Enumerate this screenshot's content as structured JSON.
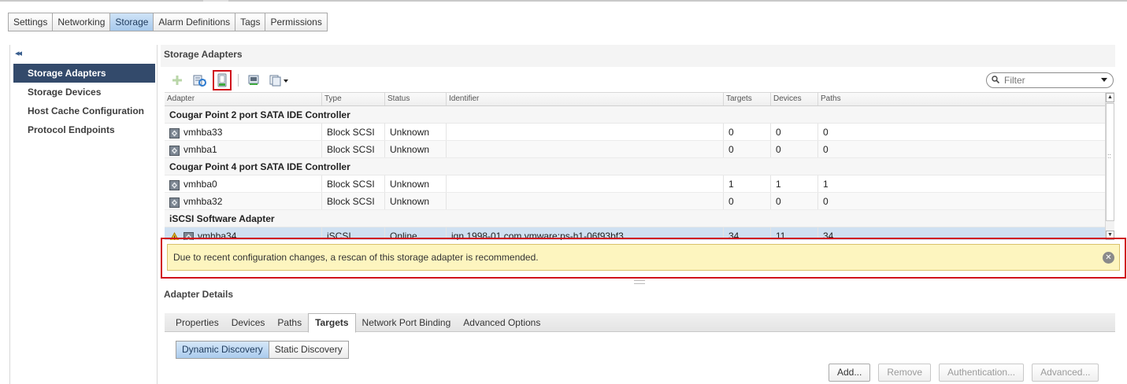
{
  "top_tabs": [
    "Settings",
    "Networking",
    "Storage",
    "Alarm Definitions",
    "Tags",
    "Permissions"
  ],
  "active_top_tab": "Storage",
  "sidebar": {
    "collapse_glyph": "◂◂",
    "items": [
      {
        "label": "Storage Adapters",
        "active": true
      },
      {
        "label": "Storage Devices",
        "active": false
      },
      {
        "label": "Host Cache Configuration",
        "active": false
      },
      {
        "label": "Protocol Endpoints",
        "active": false
      }
    ]
  },
  "main": {
    "title": "Storage Adapters",
    "toolbar_icons": [
      "add-icon",
      "rescan-all-icon",
      "rescan-adapter-icon",
      "adapter-settings-icon",
      "actions-menu-icon"
    ],
    "filter": {
      "placeholder": "Filter"
    },
    "columns": [
      "Adapter",
      "Type",
      "Status",
      "Identifier",
      "Targets",
      "Devices",
      "Paths"
    ],
    "groups": [
      {
        "name": "Cougar Point 2 port SATA IDE Controller",
        "rows": [
          {
            "adapter": "vmhba33",
            "type": "Block SCSI",
            "status": "Unknown",
            "identifier": "",
            "targets": "0",
            "devices": "0",
            "paths": "0"
          },
          {
            "adapter": "vmhba1",
            "type": "Block SCSI",
            "status": "Unknown",
            "identifier": "",
            "targets": "0",
            "devices": "0",
            "paths": "0"
          }
        ]
      },
      {
        "name": "Cougar Point 4 port SATA IDE Controller",
        "rows": [
          {
            "adapter": "vmhba0",
            "type": "Block SCSI",
            "status": "Unknown",
            "identifier": "",
            "targets": "1",
            "devices": "1",
            "paths": "1"
          },
          {
            "adapter": "vmhba32",
            "type": "Block SCSI",
            "status": "Unknown",
            "identifier": "",
            "targets": "0",
            "devices": "0",
            "paths": "0"
          }
        ]
      },
      {
        "name": "iSCSI Software Adapter",
        "rows": [
          {
            "adapter": "vmhba34",
            "type": "iSCSI",
            "status": "Online",
            "identifier": "iqn.1998-01.com.vmware:ps-h1-06f93bf3",
            "targets": "34",
            "devices": "11",
            "paths": "34",
            "warning": true,
            "selected": true
          }
        ]
      }
    ],
    "warning_banner": "Due to recent configuration changes, a rescan of this storage adapter is recommended."
  },
  "details": {
    "title": "Adapter Details",
    "tabs": [
      "Properties",
      "Devices",
      "Paths",
      "Targets",
      "Network Port Binding",
      "Advanced Options"
    ],
    "active_tab": "Targets",
    "discovery": [
      "Dynamic Discovery",
      "Static Discovery"
    ],
    "active_discovery": "Dynamic Discovery",
    "buttons": [
      {
        "label": "Add...",
        "enabled": true
      },
      {
        "label": "Remove",
        "enabled": false
      },
      {
        "label": "Authentication...",
        "enabled": false
      },
      {
        "label": "Advanced...",
        "enabled": false
      }
    ]
  }
}
